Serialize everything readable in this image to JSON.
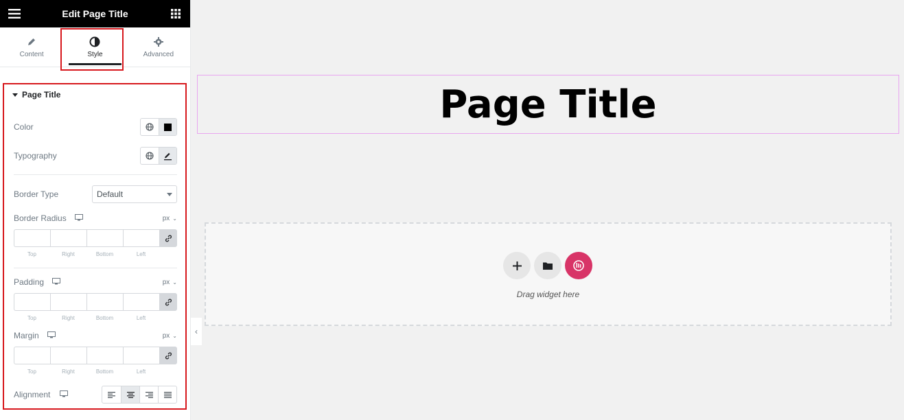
{
  "panel": {
    "title": "Edit Page Title",
    "tabs": [
      {
        "label": "Content"
      },
      {
        "label": "Style"
      },
      {
        "label": "Advanced"
      }
    ]
  },
  "section": {
    "title": "Page Title",
    "color_label": "Color",
    "typography_label": "Typography",
    "border_type_label": "Border Type",
    "border_type_value": "Default",
    "border_radius_label": "Border Radius",
    "padding_label": "Padding",
    "margin_label": "Margin",
    "alignment_label": "Alignment",
    "unit": "px",
    "dim_labels": [
      "Top",
      "Right",
      "Bottom",
      "Left"
    ]
  },
  "canvas": {
    "heading": "Page Title",
    "drag_text": "Drag widget here"
  },
  "colors": {
    "highlight": "#d7171c",
    "brand": "#d83467",
    "header_bg": "#000000"
  }
}
